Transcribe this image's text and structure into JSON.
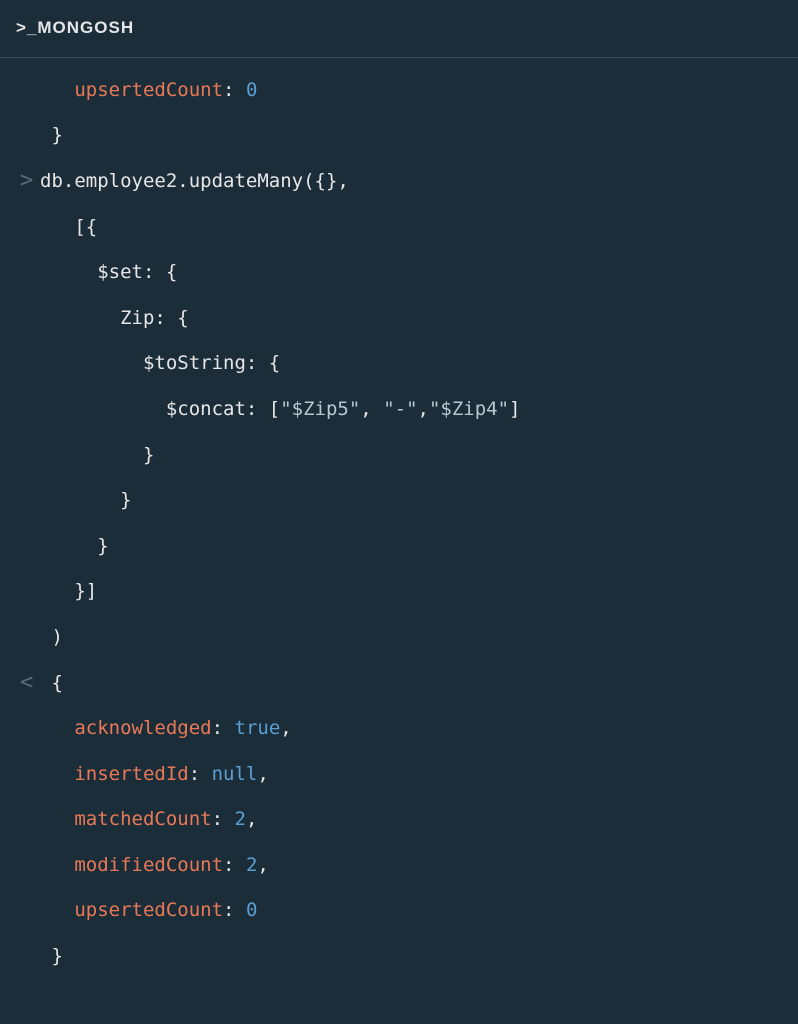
{
  "header": {
    "title": ">_MONGOSH"
  },
  "terminal": {
    "lines": [
      {
        "gutter": "",
        "segments": [
          {
            "t": "   ",
            "c": "plain"
          },
          {
            "t": "upsertedCount",
            "c": "key"
          },
          {
            "t": ": ",
            "c": "punct"
          },
          {
            "t": "0",
            "c": "num"
          }
        ]
      },
      {
        "gutter": "",
        "segments": [
          {
            "t": " }",
            "c": "punct"
          }
        ]
      },
      {
        "gutter": ">",
        "segments": [
          {
            "t": "db.employee2.updateMany({},",
            "c": "cmd"
          }
        ]
      },
      {
        "gutter": "",
        "segments": [
          {
            "t": "   [{",
            "c": "punct"
          }
        ]
      },
      {
        "gutter": "",
        "segments": [
          {
            "t": "     $set: {",
            "c": "plain"
          }
        ]
      },
      {
        "gutter": "",
        "segments": [
          {
            "t": "       Zip: {",
            "c": "plain"
          }
        ]
      },
      {
        "gutter": "",
        "segments": [
          {
            "t": "         $toString: {",
            "c": "plain"
          }
        ]
      },
      {
        "gutter": "",
        "segments": [
          {
            "t": "           $concat: [",
            "c": "plain"
          },
          {
            "t": "\"$Zip5\"",
            "c": "str"
          },
          {
            "t": ", ",
            "c": "punct"
          },
          {
            "t": "\"-\"",
            "c": "str"
          },
          {
            "t": ",",
            "c": "punct"
          },
          {
            "t": "\"$Zip4\"",
            "c": "str"
          },
          {
            "t": "]",
            "c": "punct"
          }
        ]
      },
      {
        "gutter": "",
        "segments": [
          {
            "t": "         }",
            "c": "punct"
          }
        ]
      },
      {
        "gutter": "",
        "segments": [
          {
            "t": "       }",
            "c": "punct"
          }
        ]
      },
      {
        "gutter": "",
        "segments": [
          {
            "t": "     }",
            "c": "punct"
          }
        ]
      },
      {
        "gutter": "",
        "segments": [
          {
            "t": "   }]",
            "c": "punct"
          }
        ]
      },
      {
        "gutter": "",
        "segments": [
          {
            "t": " )",
            "c": "punct"
          }
        ]
      },
      {
        "gutter": "<",
        "segments": [
          {
            "t": " {",
            "c": "punct"
          }
        ]
      },
      {
        "gutter": "",
        "segments": [
          {
            "t": "   ",
            "c": "plain"
          },
          {
            "t": "acknowledged",
            "c": "key"
          },
          {
            "t": ": ",
            "c": "punct"
          },
          {
            "t": "true",
            "c": "bool"
          },
          {
            "t": ",",
            "c": "punct"
          }
        ]
      },
      {
        "gutter": "",
        "segments": [
          {
            "t": "   ",
            "c": "plain"
          },
          {
            "t": "insertedId",
            "c": "key"
          },
          {
            "t": ": ",
            "c": "punct"
          },
          {
            "t": "null",
            "c": "null"
          },
          {
            "t": ",",
            "c": "punct"
          }
        ]
      },
      {
        "gutter": "",
        "segments": [
          {
            "t": "   ",
            "c": "plain"
          },
          {
            "t": "matchedCount",
            "c": "key"
          },
          {
            "t": ": ",
            "c": "punct"
          },
          {
            "t": "2",
            "c": "num"
          },
          {
            "t": ",",
            "c": "punct"
          }
        ]
      },
      {
        "gutter": "",
        "segments": [
          {
            "t": "   ",
            "c": "plain"
          },
          {
            "t": "modifiedCount",
            "c": "key"
          },
          {
            "t": ": ",
            "c": "punct"
          },
          {
            "t": "2",
            "c": "num"
          },
          {
            "t": ",",
            "c": "punct"
          }
        ]
      },
      {
        "gutter": "",
        "segments": [
          {
            "t": "   ",
            "c": "plain"
          },
          {
            "t": "upsertedCount",
            "c": "key"
          },
          {
            "t": ": ",
            "c": "punct"
          },
          {
            "t": "0",
            "c": "num"
          }
        ]
      },
      {
        "gutter": "",
        "segments": [
          {
            "t": " }",
            "c": "punct"
          }
        ]
      }
    ]
  }
}
